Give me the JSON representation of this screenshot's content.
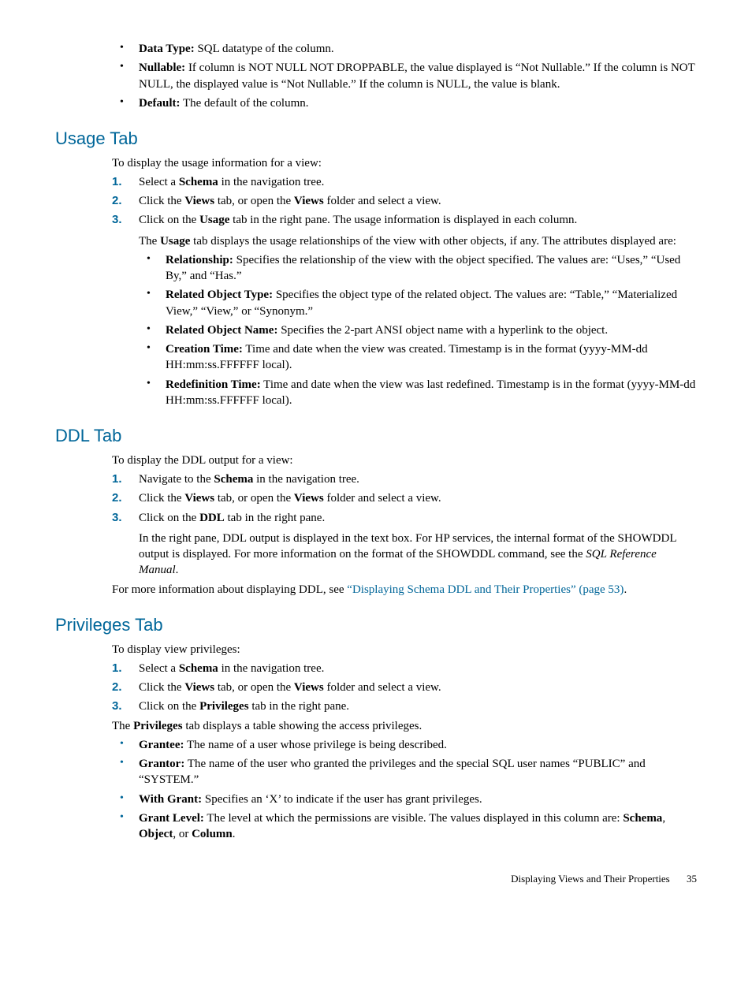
{
  "top_bullets": [
    {
      "label": "Data Type:",
      "text": " SQL datatype of the column."
    },
    {
      "label": "Nullable:",
      "text": " If column is NOT NULL NOT DROPPABLE, the value displayed is “Not Nullable.” If the column is NOT NULL, the displayed value is “Not Nullable.” If the column is NULL, the value is blank."
    },
    {
      "label": "Default:",
      "text": " The default of the column."
    }
  ],
  "usage": {
    "heading": "Usage Tab",
    "intro": "To display the usage information for a view:",
    "steps": [
      {
        "pre": "Select a ",
        "bold": "Schema",
        "post": " in the navigation tree."
      },
      {
        "pre": "Click the ",
        "bold": "Views",
        "mid": " tab, or open the ",
        "bold2": "Views",
        "post": " folder and select a view."
      },
      {
        "pre": "Click on the ",
        "bold": "Usage",
        "post": " tab in the right pane. The usage information is displayed in each column."
      }
    ],
    "step3_para_pre": "The ",
    "step3_para_bold": "Usage",
    "step3_para_post": " tab displays the usage relationships of the view with other objects, if any. The attributes displayed are:",
    "attrs": [
      {
        "label": "Relationship:",
        "text": " Specifies the relationship of the view with the object specified. The values are: “Uses,” “Used By,” and “Has.”"
      },
      {
        "label": "Related Object Type:",
        "text": " Specifies the object type of the related object. The values are: “Table,” “Materialized View,” “View,” or “Synonym.”"
      },
      {
        "label": "Related Object Name:",
        "text": " Specifies the 2-part ANSI object name with a hyperlink to the object."
      },
      {
        "label": "Creation Time:",
        "text": " Time and date when the view was created. Timestamp is in the format (yyyy-MM-dd HH:mm:ss.FFFFFF local)."
      },
      {
        "label": "Redefinition Time:",
        "text": " Time and date when the view was last redefined. Timestamp is in the format (yyyy-MM-dd HH:mm:ss.FFFFFF local)."
      }
    ]
  },
  "ddl": {
    "heading": "DDL Tab",
    "intro": "To display the DDL output for a view:",
    "steps": [
      {
        "pre": "Navigate to the ",
        "bold": "Schema",
        "post": " in the navigation tree."
      },
      {
        "pre": "Click the ",
        "bold": "Views",
        "mid": " tab, or open the ",
        "bold2": "Views",
        "post": " folder and select a view."
      },
      {
        "pre": "Click on the ",
        "bold": "DDL",
        "post": " tab in the right pane."
      }
    ],
    "step3_para": "In the right pane, DDL output is displayed in the text box. For HP services, the internal format of the SHOWDDL output is displayed. For more information on the format of the SHOWDDL command, see the ",
    "step3_em": "SQL Reference Manual",
    "step3_end": ".",
    "after_pre": "For more information about displaying DDL, see ",
    "after_link": "“Displaying Schema DDL and Their Properties” (page 53)",
    "after_end": "."
  },
  "priv": {
    "heading": "Privileges Tab",
    "intro": "To display view privileges:",
    "steps": [
      {
        "pre": "Select a ",
        "bold": "Schema",
        "post": " in the navigation tree."
      },
      {
        "pre": "Click the ",
        "bold": "Views",
        "mid": " tab, or open the ",
        "bold2": "Views",
        "post": " folder and select a view."
      },
      {
        "pre": "Click on the ",
        "bold": "Privileges",
        "post": " tab in the right pane."
      }
    ],
    "after_pre": "The ",
    "after_bold": "Privileges",
    "after_post": " tab displays a table showing the access privileges.",
    "attrs": [
      {
        "label": "Grantee:",
        "text": " The name of a user whose privilege is being described."
      },
      {
        "label": "Grantor:",
        "text": " The name of the user who granted the privileges and the special SQL user names “PUBLIC” and “SYSTEM.”"
      },
      {
        "label": "With Grant:",
        "text": " Specifies an ‘X’ to indicate if the user has grant privileges."
      },
      {
        "label": "Grant Level:",
        "text_pre": " The level at which the permissions are visible. The values displayed in this column are: ",
        "v1": "Schema",
        "sep1": ", ",
        "v2": "Object",
        "sep2": ", or ",
        "v3": "Column",
        "text_post": "."
      }
    ]
  },
  "footer": {
    "title": "Displaying Views and Their Properties",
    "page": "35"
  }
}
